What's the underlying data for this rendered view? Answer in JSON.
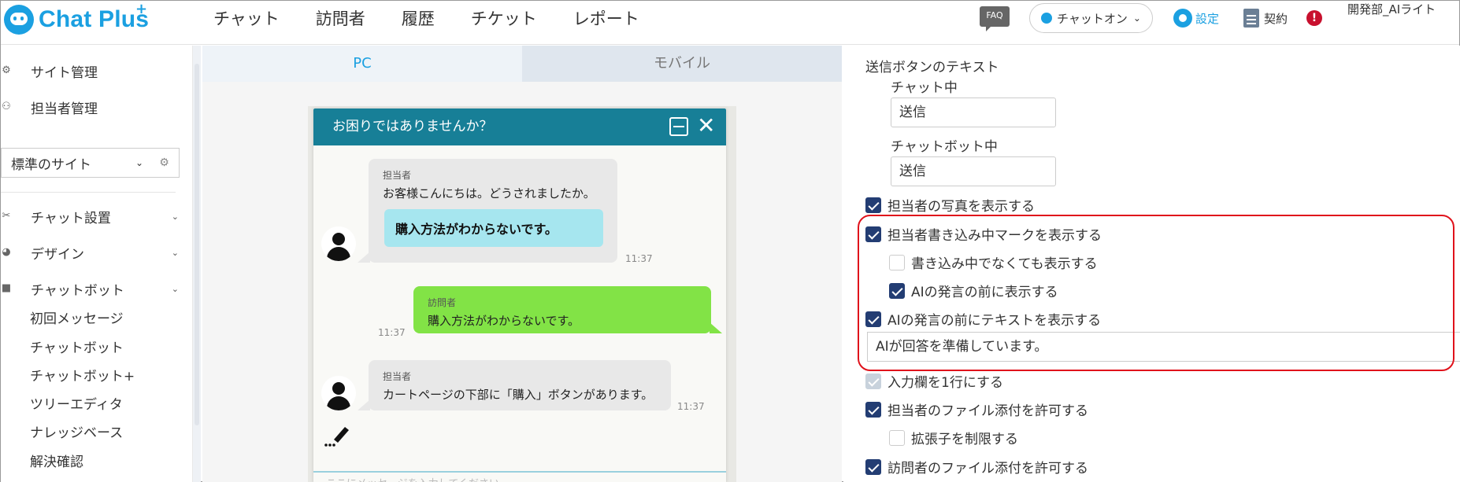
{
  "header": {
    "logo_text": "Chat Plus",
    "logo_sup": "+",
    "nav": [
      "チャット",
      "訪問者",
      "履歴",
      "チケット",
      "レポート"
    ],
    "faq": "FAQ",
    "status": "チャットオン",
    "settings_label": "設定",
    "contract_label": "契約",
    "alert": "!",
    "user_name": "開発部_AIライト"
  },
  "sidebar": {
    "top_items": [
      "サイト管理",
      "担当者管理"
    ],
    "site_select": "標準のサイト",
    "sections": [
      "チャット設置",
      "デザイン",
      "チャットボット"
    ],
    "chatbot_sub": [
      "初回メッセージ",
      "チャットボット",
      "チャットボット+",
      "ツリーエディタ",
      "ナレッジベース",
      "解決確認"
    ]
  },
  "preview": {
    "tab_pc": "PC",
    "tab_mobile": "モバイル",
    "widget_title": "お困りではありませんか？",
    "messages": [
      {
        "who": "担当者",
        "text": "お客様こんにちは。どうされましたか。",
        "quick": "購入方法がわからないです。",
        "time": "11:37"
      },
      {
        "who": "訪問者",
        "text": "購入方法がわからないです。",
        "time": "11:37"
      },
      {
        "who": "担当者",
        "text": "カートページの下部に「購入」ボタンがあります。",
        "time": "11:37"
      }
    ],
    "input_placeholder": "ここにメッセージを入力してください"
  },
  "settings": {
    "send_button_text_title": "送信ボタンのテキスト",
    "chatting_label": "チャット中",
    "chatting_value": "送信",
    "chatbot_label": "チャットボット中",
    "chatbot_value": "送信",
    "options": [
      {
        "label": "担当者の写真を表示する",
        "checked": true
      },
      {
        "label": "担当者書き込み中マークを表示する",
        "checked": true
      },
      {
        "label": "書き込み中でなくても表示する",
        "checked": false
      },
      {
        "label": "AIの発言の前に表示する",
        "checked": true
      },
      {
        "label": "AIの発言の前にテキストを表示する",
        "checked": true
      },
      {
        "label": "入力欄を1行にする",
        "checked": true,
        "disabled": true
      },
      {
        "label": "担当者のファイル添付を許可する",
        "checked": true
      },
      {
        "label": "拡張子を制限する",
        "checked": false
      },
      {
        "label": "訪問者のファイル添付を許可する",
        "checked": true
      }
    ],
    "ai_text_value": "AIが回答を準備しています。"
  },
  "colors": {
    "brand": "#1ba0e1",
    "widget_header": "#177f97",
    "visitor_bubble": "#82e346",
    "quick_reply": "#a6e6ef",
    "checkbox_on": "#233d73",
    "highlight": "#e0121b"
  }
}
